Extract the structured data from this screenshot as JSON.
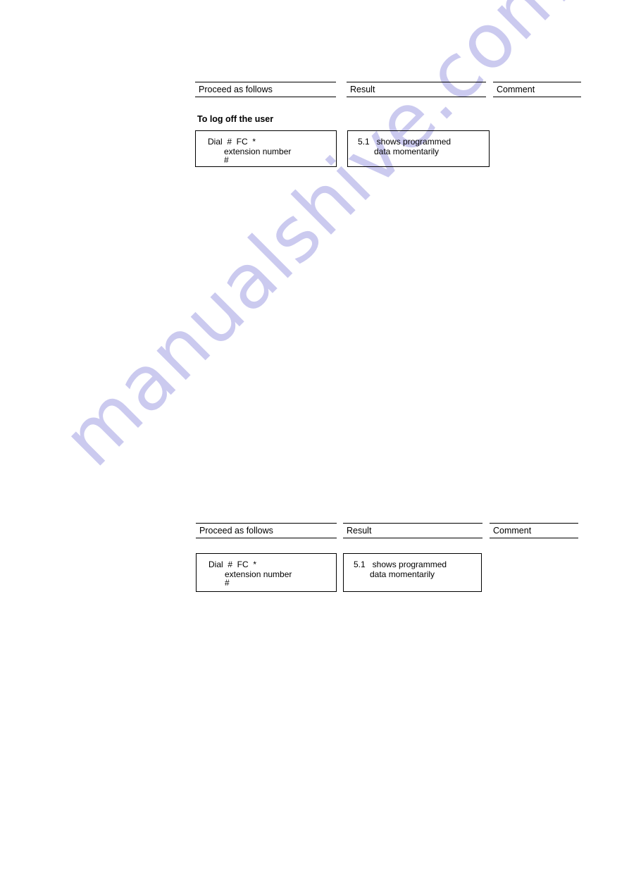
{
  "document": {
    "watermark": "manualshive.com",
    "watermark_color": "#c9c8ef",
    "background_color": "#ffffff",
    "text_color": "#000000"
  },
  "tables": [
    {
      "id": "table-top",
      "columns": [
        {
          "label": "Proceed as follows"
        },
        {
          "label": "Result"
        },
        {
          "label": "Comment"
        }
      ],
      "section_title": "To log off the user",
      "rows": [
        {
          "procedure": {
            "line1": "Dial  #  FC  *",
            "line2": "extension number",
            "line3": "#"
          },
          "result": {
            "line1": "5.1   shows programmed",
            "line2": "data momentarily"
          },
          "comment": ""
        }
      ]
    },
    {
      "id": "table-bottom",
      "columns": [
        {
          "label": "Proceed as follows"
        },
        {
          "label": "Result"
        },
        {
          "label": "Comment"
        }
      ],
      "section_title": "",
      "rows": [
        {
          "procedure": {
            "line1": "Dial  #  FC  *",
            "line2": "extension number",
            "line3": "#"
          },
          "result": {
            "line1": "5.1   shows programmed",
            "line2": "data momentarily"
          },
          "comment": ""
        }
      ]
    }
  ]
}
